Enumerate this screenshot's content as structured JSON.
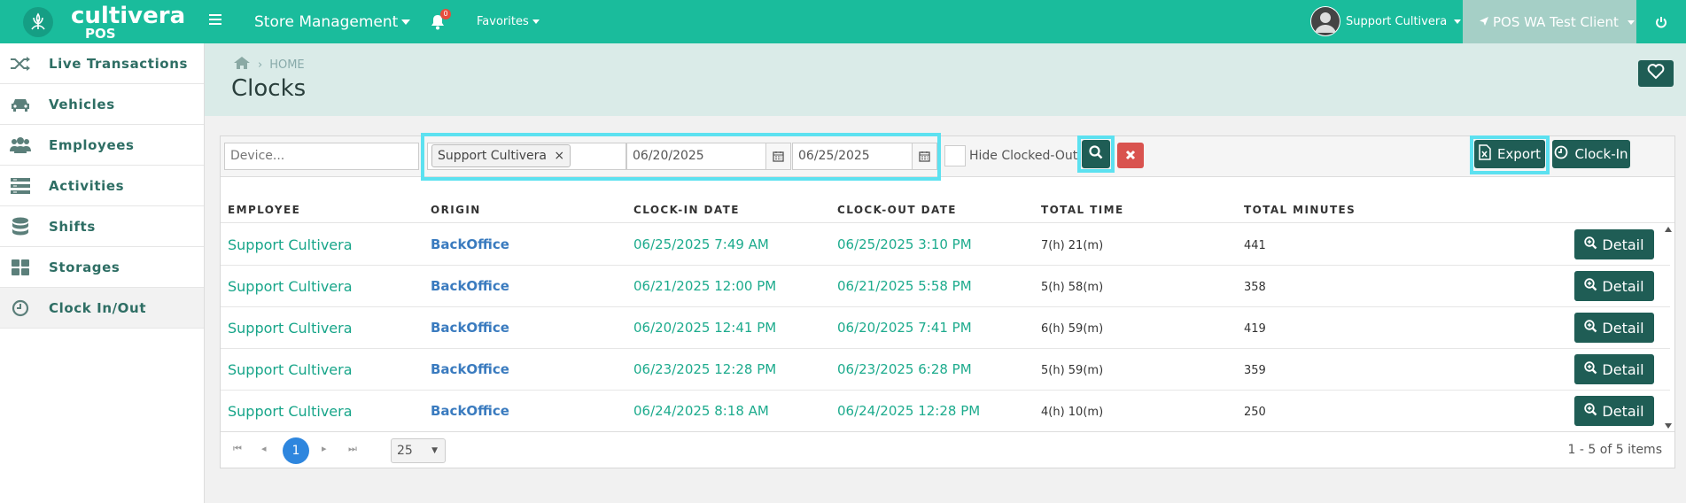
{
  "app": {
    "brand": "cultivera",
    "brand_sub": "POS"
  },
  "topbar": {
    "menu_title": "Store Management",
    "notification_count": "0",
    "favorites": "Favorites",
    "user": "Support Cultivera",
    "client": "POS WA Test Client"
  },
  "sidebar": {
    "items": [
      {
        "label": "Live Transactions",
        "icon": "shuffle-icon"
      },
      {
        "label": "Vehicles",
        "icon": "car-icon"
      },
      {
        "label": "Employees",
        "icon": "users-icon"
      },
      {
        "label": "Activities",
        "icon": "list-icon"
      },
      {
        "label": "Shifts",
        "icon": "database-icon"
      },
      {
        "label": "Storages",
        "icon": "grid-icon"
      },
      {
        "label": "Clock In/Out",
        "icon": "clock-icon"
      }
    ]
  },
  "page": {
    "breadcrumb": "HOME",
    "title": "Clocks"
  },
  "filters": {
    "device_placeholder": "Device...",
    "employee_tag": "Support Cultivera",
    "date_from": "06/20/2025",
    "date_to": "06/25/2025",
    "hide_label": "Hide Clocked-Out"
  },
  "actions": {
    "export": "Export",
    "clock_in": "Clock-In",
    "detail": "Detail"
  },
  "table": {
    "headers": [
      "EMPLOYEE",
      "ORIGIN",
      "CLOCK-IN DATE",
      "CLOCK-OUT DATE",
      "TOTAL TIME",
      "TOTAL MINUTES"
    ],
    "rows": [
      {
        "employee": "Support Cultivera",
        "origin": "BackOffice",
        "clock_in": "06/25/2025 7:49 AM",
        "clock_out": "06/25/2025 3:10 PM",
        "total_time": "7(h) 21(m)",
        "total_minutes": "441"
      },
      {
        "employee": "Support Cultivera",
        "origin": "BackOffice",
        "clock_in": "06/21/2025 12:00 PM",
        "clock_out": "06/21/2025 5:58 PM",
        "total_time": "5(h) 58(m)",
        "total_minutes": "358"
      },
      {
        "employee": "Support Cultivera",
        "origin": "BackOffice",
        "clock_in": "06/20/2025 12:41 PM",
        "clock_out": "06/20/2025 7:41 PM",
        "total_time": "6(h) 59(m)",
        "total_minutes": "419"
      },
      {
        "employee": "Support Cultivera",
        "origin": "BackOffice",
        "clock_in": "06/23/2025 12:28 PM",
        "clock_out": "06/23/2025 6:28 PM",
        "total_time": "5(h) 59(m)",
        "total_minutes": "359"
      },
      {
        "employee": "Support Cultivera",
        "origin": "BackOffice",
        "clock_in": "06/24/2025 8:18 AM",
        "clock_out": "06/24/2025 12:28 PM",
        "total_time": "4(h) 10(m)",
        "total_minutes": "250"
      }
    ]
  },
  "pager": {
    "current": "1",
    "page_size": "25",
    "info": "1 - 5 of 5 items"
  },
  "colors": {
    "brand": "#1abc9c",
    "dark": "#1f5d55",
    "highlight": "#5ce1f0",
    "link": "#3a7bbf"
  }
}
